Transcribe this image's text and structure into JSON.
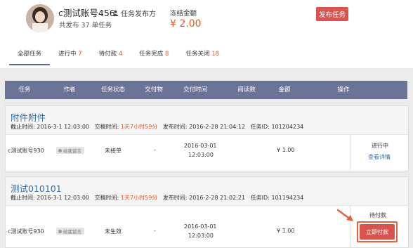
{
  "profile": {
    "username": "c测试账号456",
    "publisher_tag": "任务发布方",
    "published_count": "共发布 37 单任务",
    "frozen_label": "冻结金额",
    "frozen_amount": "¥ 2.00",
    "publish_button": "发布任务"
  },
  "tabs": [
    {
      "label": "全部任务",
      "count": ""
    },
    {
      "label": "进行中",
      "count": "7"
    },
    {
      "label": "待付款",
      "count": "4"
    },
    {
      "label": "任务完成",
      "count": "8"
    },
    {
      "label": "任务关闭",
      "count": "18"
    }
  ],
  "table_headers": [
    "任务",
    "作者",
    "任务状态",
    "交付物",
    "交付时间",
    "阅读数",
    "金额",
    "操作"
  ],
  "tasks": [
    {
      "title": "附件附件",
      "deadline": "截止时间: 2016-3-1 12:03:00",
      "delivery_label": "交稿时间:",
      "delivery_time": "1天7小时59分",
      "publish_time": "发布时间: 2016-2-28 21:04:12",
      "task_id": "任务ID: 101204234",
      "author": "c测试账号930",
      "msg_tag": "给我留言",
      "status": "未接单",
      "deliverable": "-",
      "delivery_date": "2016-03-01",
      "delivery_clock": "12:03:00",
      "reads": "",
      "amount": "¥ 1.00",
      "op_status": "进行中",
      "op_link": "查看详情"
    },
    {
      "title": "测试010101",
      "deadline": "截止时间: 2016-3-1 12:03:00",
      "delivery_label": "交稿时间:",
      "delivery_time": "1天7小时59分",
      "publish_time": "发布时间: 2016-2-28 21:02:21",
      "task_id": "任务ID: 101194234",
      "author": "c测试账号930",
      "msg_tag": "给我留言",
      "status": "未生效",
      "deliverable": "-",
      "delivery_date": "2016-03-01",
      "delivery_clock": "12:03:00",
      "reads": "",
      "amount": "¥ 1.00",
      "op_status": "待付款",
      "op_button": "立即付款"
    }
  ],
  "colors": {
    "header_bg": "#6b7396",
    "accent_orange": "#e05a2b",
    "button_red": "#d9534f",
    "link_blue": "#3a6ea5",
    "arrow_red": "#e8603c"
  }
}
